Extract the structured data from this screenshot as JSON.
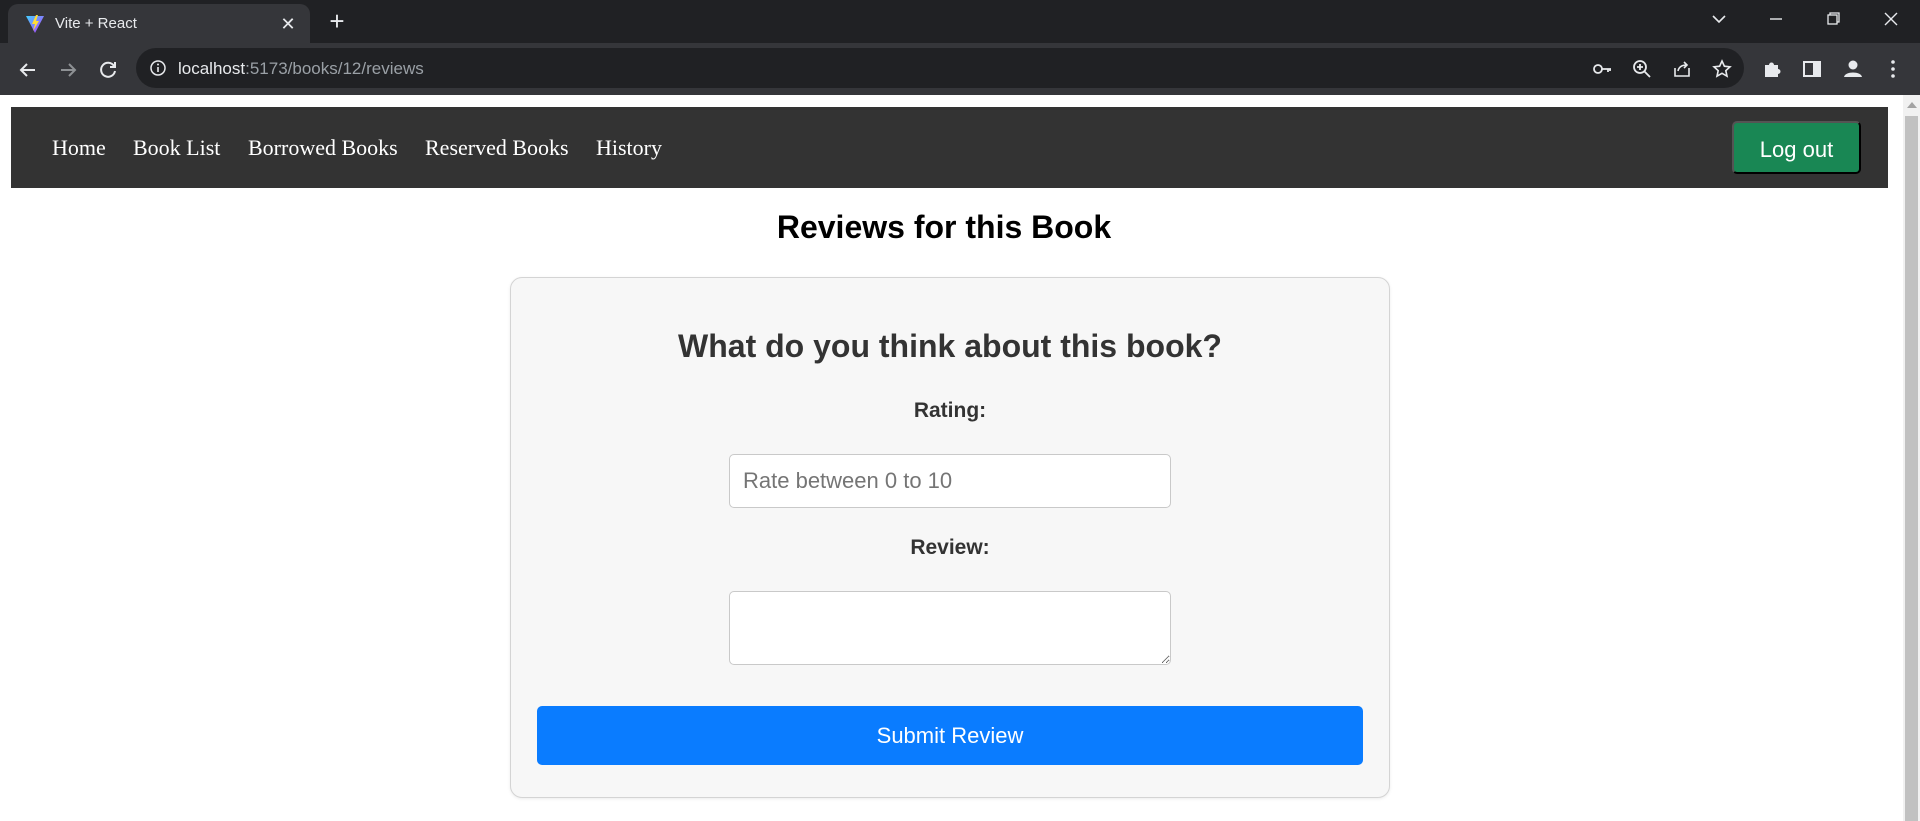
{
  "browser": {
    "tab_title": "Vite + React",
    "tab_close_glyph": "✕",
    "new_tab_glyph": "+",
    "url_host": "localhost",
    "url_path": ":5173/books/12/reviews",
    "icons": [
      "vite-favicon",
      "close-icon",
      "plus-icon",
      "chevron-down-icon",
      "minimize-icon",
      "restore-icon",
      "window-close-icon",
      "back-arrow-icon",
      "forward-arrow-icon",
      "reload-icon",
      "info-icon",
      "key-icon",
      "zoom-icon",
      "share-icon",
      "star-icon",
      "extensions-icon",
      "side-panel-icon",
      "profile-icon",
      "menu-icon"
    ]
  },
  "navbar": {
    "links": [
      "Home",
      "Book List",
      "Borrowed Books",
      "Reserved Books",
      "History"
    ],
    "logout_label": "Log out",
    "background": "#333333",
    "logout_color": "#198754"
  },
  "page": {
    "title": "Reviews for this Book"
  },
  "review_form": {
    "heading": "What do you think about this book?",
    "rating_label": "Rating:",
    "rating_placeholder": "Rate between 0 to 10",
    "rating_value": "",
    "review_label": "Review:",
    "review_value": "",
    "submit_label": "Submit Review",
    "submit_color": "#0a7cff"
  }
}
